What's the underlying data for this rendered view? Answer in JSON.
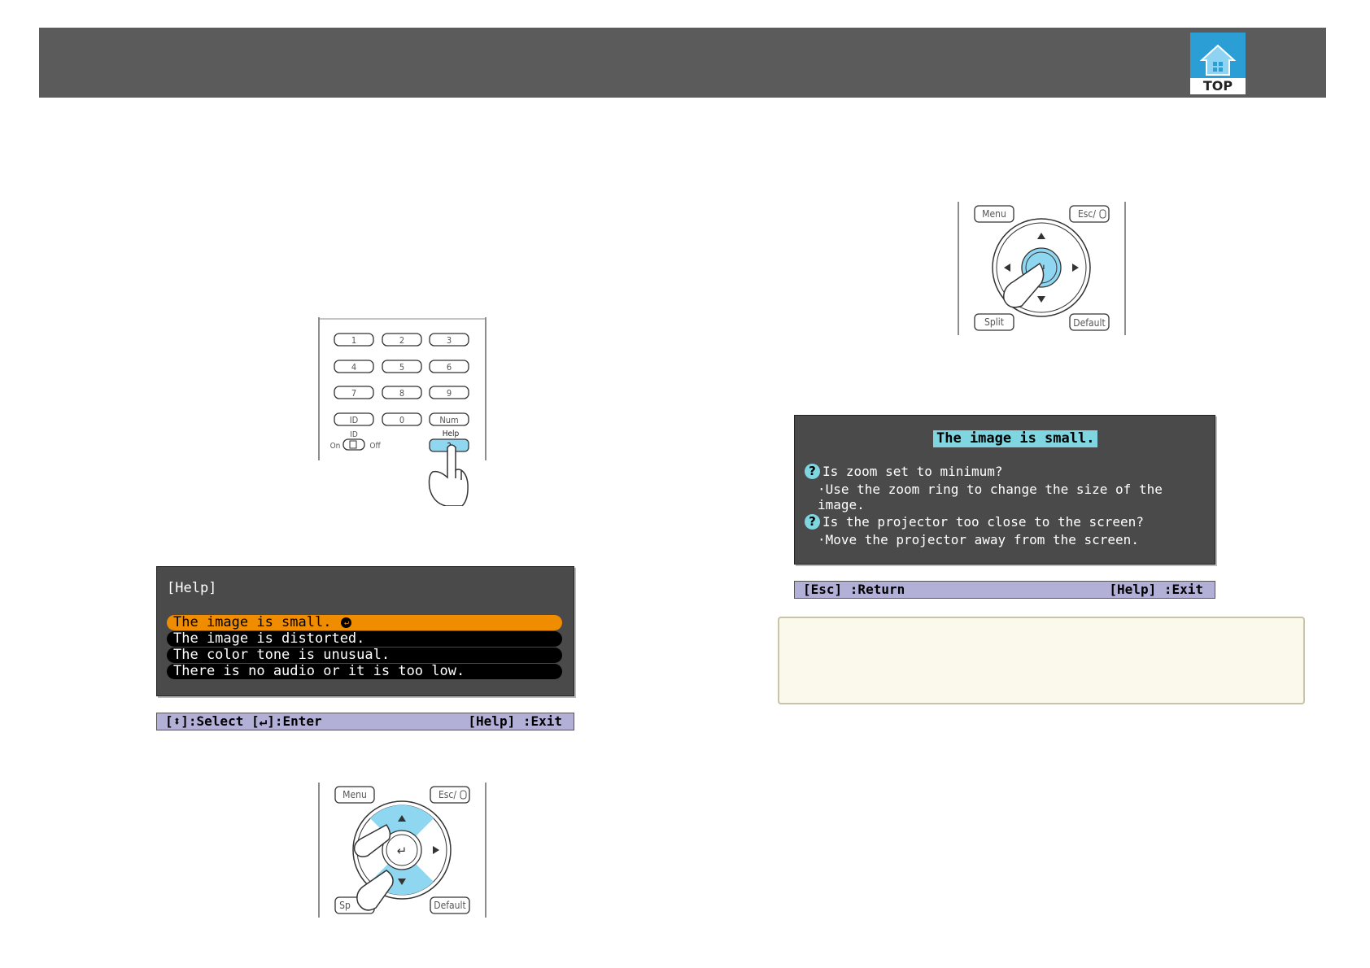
{
  "header": {
    "logo_label": "TOP"
  },
  "remote_numpad": {
    "keys": [
      "1",
      "2",
      "3",
      "4",
      "5",
      "6",
      "7",
      "8",
      "9",
      "ID",
      "0",
      "Num"
    ],
    "id_switch_label": "ID",
    "on_label": "On",
    "off_label": "Off",
    "help_label": "Help",
    "help_key": "?"
  },
  "help_menu": {
    "title": "[Help]",
    "items": [
      "The image is small.",
      "The image is distorted.",
      "The color tone is unusual.",
      "There is no audio or it is too low."
    ],
    "guide_left": "[⬍]:Select  [↵]:Enter",
    "guide_right": "[Help] :Exit"
  },
  "control_panel": {
    "menu_label": "Menu",
    "esc_label": "Esc/",
    "split_label": "Split",
    "default_label": "Default",
    "split_partial_label": "Sp"
  },
  "help_detail": {
    "title": "The image is small.",
    "q1": "Is zoom set to minimum?",
    "a1": "·Use the zoom ring to change the size of the image.",
    "q2": "Is the projector too close to the screen?",
    "a2": "·Move the projector away from the screen.",
    "guide_left": "[Esc] :Return",
    "guide_right": "[Help] :Exit"
  },
  "colors": {
    "header": "#5b5b5b",
    "accent": "#2b9ed6",
    "highlight": "#7fd6e0",
    "selected": "#f08c00",
    "note_bg": "#fbf9ec"
  }
}
